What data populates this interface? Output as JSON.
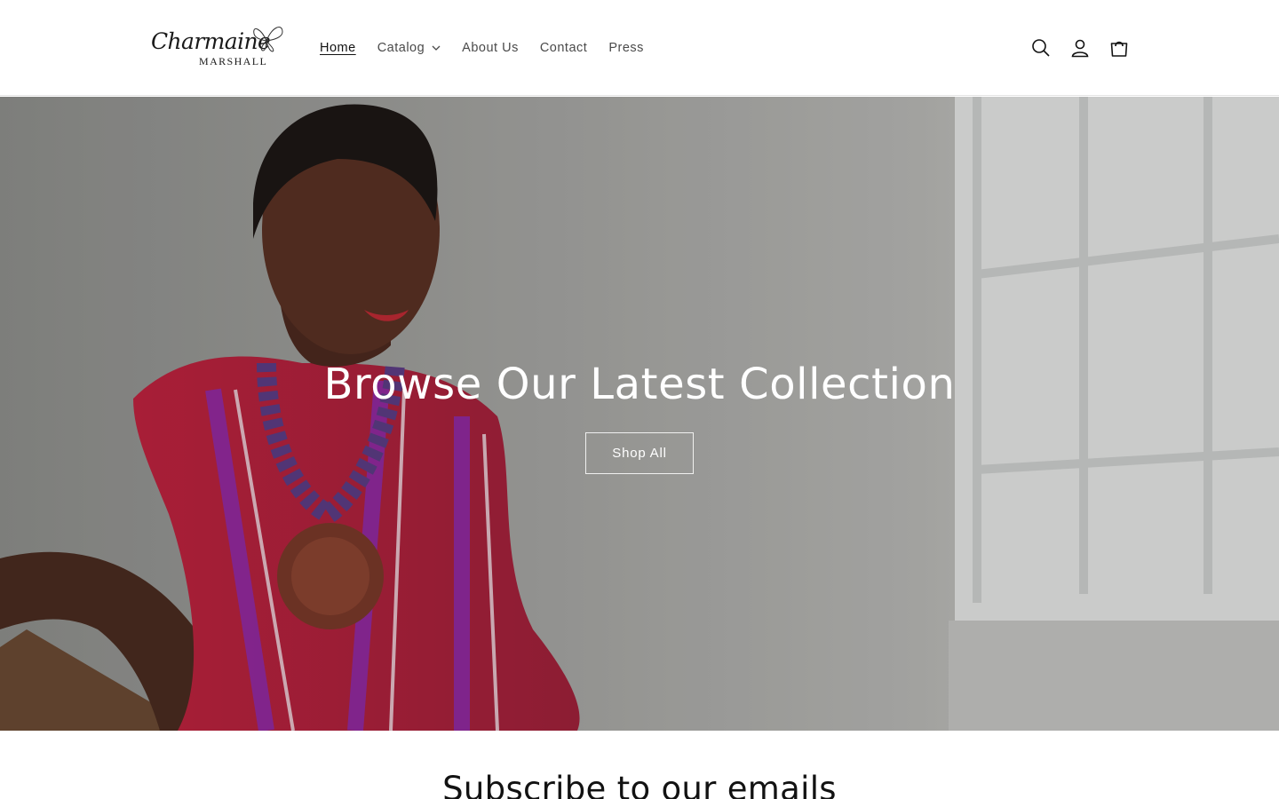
{
  "brand": {
    "logo_script": "Charmaine",
    "logo_caps": "MARSHALL"
  },
  "nav": {
    "items": [
      {
        "label": "Home",
        "active": true
      },
      {
        "label": "Catalog",
        "has_dropdown": true
      },
      {
        "label": "About Us"
      },
      {
        "label": "Contact"
      },
      {
        "label": "Press"
      }
    ]
  },
  "header_icons": [
    "search-icon",
    "account-icon",
    "cart-icon"
  ],
  "hero": {
    "title": "Browse Our Latest Collection",
    "button_label": "Shop All"
  },
  "subscribe": {
    "title": "Subscribe to our emails"
  },
  "colors": {
    "text": "#121212",
    "nav_text": "#4a4a4a",
    "hero_text": "#ffffff",
    "background": "#ffffff"
  }
}
